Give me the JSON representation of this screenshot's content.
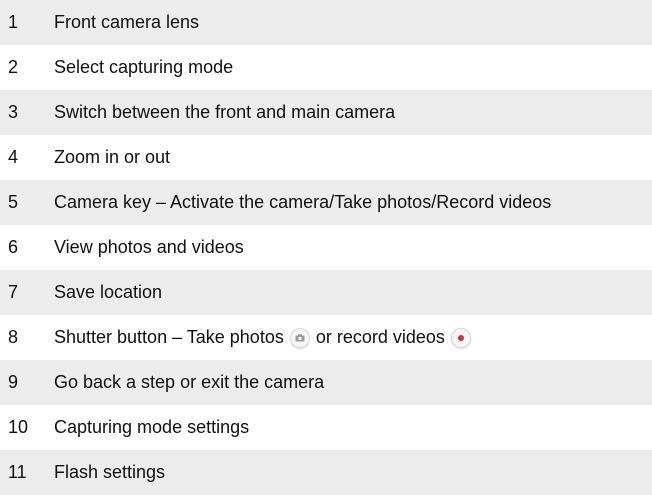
{
  "rows": [
    {
      "num": "1",
      "text": "Front camera lens"
    },
    {
      "num": "2",
      "text": "Select capturing mode"
    },
    {
      "num": "3",
      "text": "Switch between the front and main camera"
    },
    {
      "num": "4",
      "text": "Zoom in or out"
    },
    {
      "num": "5",
      "text": "Camera key – Activate the camera/Take photos/Record videos"
    },
    {
      "num": "6",
      "text": "View photos and videos"
    },
    {
      "num": "7",
      "text": "Save location"
    },
    {
      "num": "8",
      "text_a": "Shutter button – Take photos",
      "text_b": "or record videos"
    },
    {
      "num": "9",
      "text": "Go back a step or exit the camera"
    },
    {
      "num": "10",
      "text": "Capturing mode settings"
    },
    {
      "num": "11",
      "text": "Flash settings"
    }
  ],
  "colors": {
    "shade": "#ececec",
    "record_dot": "#e8262b"
  },
  "icons": {
    "photo": "camera-icon",
    "video": "record-icon"
  }
}
